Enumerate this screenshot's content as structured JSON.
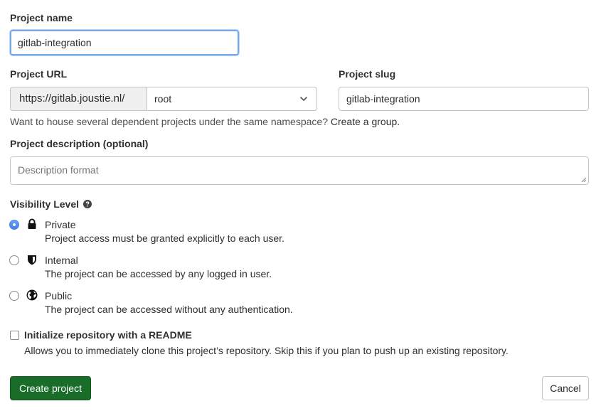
{
  "project_name": {
    "label": "Project name",
    "value": "gitlab-integration"
  },
  "project_url": {
    "label": "Project URL",
    "prefix": "https://gitlab.joustie.nl/",
    "namespace": "root"
  },
  "project_slug": {
    "label": "Project slug",
    "value": "gitlab-integration"
  },
  "namespace_help": {
    "text": "Want to house several dependent projects under the same namespace?",
    "link": "Create a group."
  },
  "description": {
    "label": "Project description (optional)",
    "placeholder": "Description format"
  },
  "visibility": {
    "label": "Visibility Level",
    "options": [
      {
        "title": "Private",
        "desc": "Project access must be granted explicitly to each user.",
        "icon": "lock-icon",
        "checked": true
      },
      {
        "title": "Internal",
        "desc": "The project can be accessed by any logged in user.",
        "icon": "shield-icon",
        "checked": false
      },
      {
        "title": "Public",
        "desc": "The project can be accessed without any authentication.",
        "icon": "earth-icon",
        "checked": false
      }
    ]
  },
  "readme": {
    "label": "Initialize repository with a README",
    "desc": "Allows you to immediately clone this project’s repository. Skip this if you plan to push up an existing repository.",
    "checked": false
  },
  "buttons": {
    "create": "Create project",
    "cancel": "Cancel"
  },
  "colors": {
    "primary": "#1a6c29",
    "focus": "#75a7e8",
    "radio_checked": "#4a86e8"
  }
}
